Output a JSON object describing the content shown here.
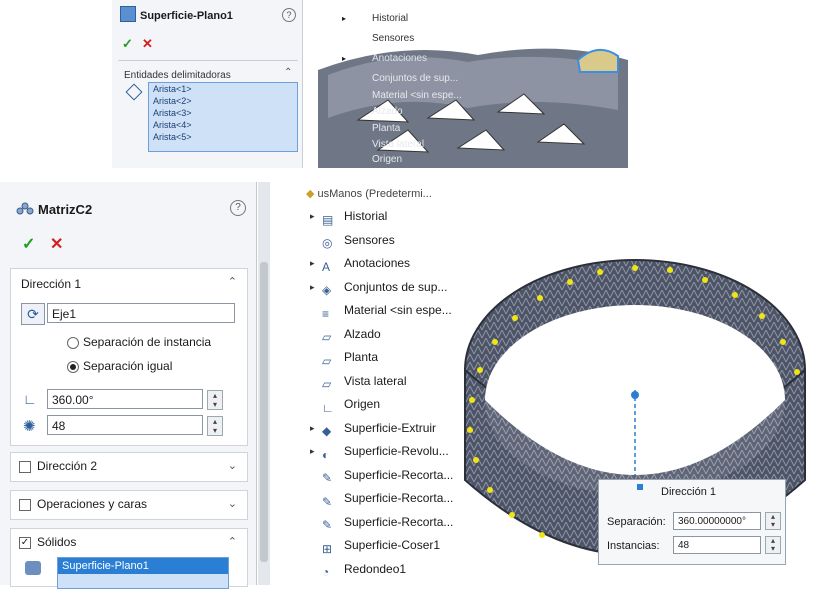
{
  "top_panel": {
    "title": "Superficie-Plano1",
    "section": "Entidades delimitadoras",
    "edges": [
      "Arista<1>",
      "Arista<2>",
      "Arista<3>",
      "Arista<4>",
      "Arista<5>"
    ]
  },
  "top_tree": {
    "items": [
      "Historial",
      "Sensores",
      "Anotaciones",
      "Conjuntos de sup...",
      "Material <sin espe...",
      "Alzado",
      "Planta",
      "Vista lateral",
      "Origen"
    ]
  },
  "pm": {
    "title": "MatrizC2",
    "direction1": {
      "label": "Dirección 1",
      "axis": "Eje1",
      "opt_instance": "Separación de instancia",
      "opt_equal": "Separación igual",
      "angle": "360.00°",
      "count": "48"
    },
    "direction2_label": "Dirección 2",
    "ops_label": "Operaciones y caras",
    "solids_label": "Sólidos",
    "solid_item": "Superficie-Plano1"
  },
  "tree": {
    "header": "usManos (Predetermi...",
    "items": [
      {
        "label": "Historial",
        "icon": "history-icon",
        "arrow": true
      },
      {
        "label": "Sensores",
        "icon": "sensor-icon",
        "arrow": false
      },
      {
        "label": "Anotaciones",
        "icon": "annotation-icon",
        "arrow": true
      },
      {
        "label": "Conjuntos de sup...",
        "icon": "surface-bodies-icon",
        "arrow": true
      },
      {
        "label": "Material <sin espe...",
        "icon": "material-icon",
        "arrow": false
      },
      {
        "label": "Alzado",
        "icon": "plane-icon",
        "arrow": false
      },
      {
        "label": "Planta",
        "icon": "plane-icon",
        "arrow": false
      },
      {
        "label": "Vista lateral",
        "icon": "plane-icon",
        "arrow": false
      },
      {
        "label": "Origen",
        "icon": "origin-icon",
        "arrow": false
      },
      {
        "label": "Superficie-Extruir",
        "icon": "extrude-surface-icon",
        "arrow": true
      },
      {
        "label": "Superficie-Revolu...",
        "icon": "revolve-surface-icon",
        "arrow": true
      },
      {
        "label": "Superficie-Recorta...",
        "icon": "trim-surface-icon",
        "arrow": false
      },
      {
        "label": "Superficie-Recorta...",
        "icon": "trim-surface-icon",
        "arrow": false
      },
      {
        "label": "Superficie-Recorta...",
        "icon": "trim-surface-icon",
        "arrow": false
      },
      {
        "label": "Superficie-Coser1",
        "icon": "knit-surface-icon",
        "arrow": false
      },
      {
        "label": "Redondeo1",
        "icon": "fillet-icon",
        "arrow": false
      }
    ]
  },
  "dialog": {
    "title": "Dirección 1",
    "sep_label": "Separación:",
    "sep_value": "360.00000000°",
    "inst_label": "Instancias:",
    "inst_value": "48"
  },
  "colors": {
    "accent": "#2a7fd4",
    "selection": "#cfe1f7",
    "panel": "#f3f5f8"
  }
}
